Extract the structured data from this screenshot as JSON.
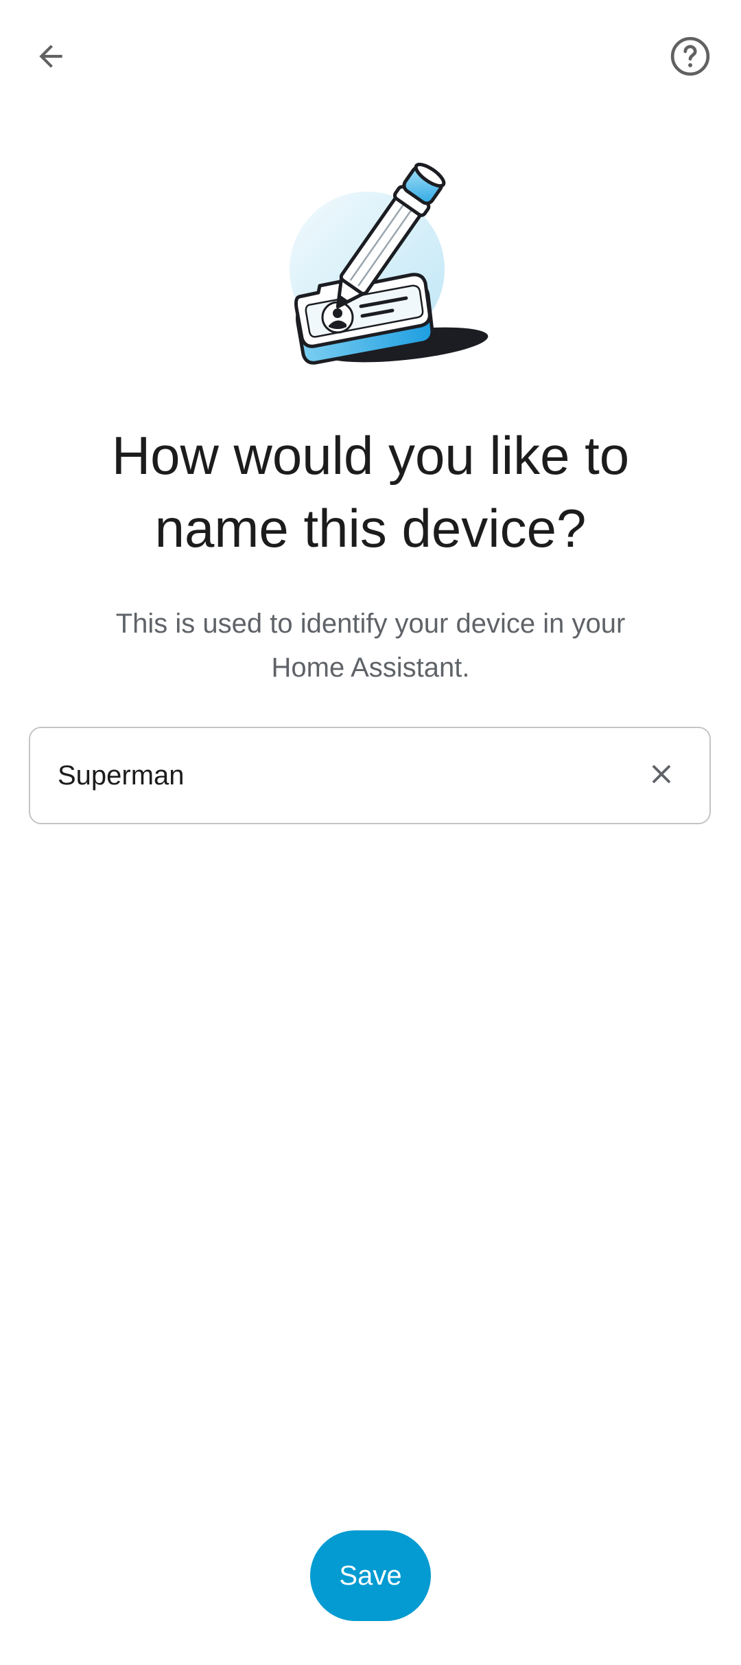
{
  "header": {
    "back_icon": "arrow-back-icon",
    "help_icon": "help-circle-icon"
  },
  "illustration": {
    "icon": "pencil-id-card-illustration",
    "accent_color": "#3ab4ec",
    "light_accent_color": "#e3f4fb"
  },
  "content": {
    "title": "How would you like to name this device?",
    "subtitle": "This is used to identify your device in your Home Assistant."
  },
  "name_field": {
    "value": "Superman",
    "clear_icon": "close-icon"
  },
  "actions": {
    "save_label": "Save",
    "save_color": "#039bd1"
  }
}
